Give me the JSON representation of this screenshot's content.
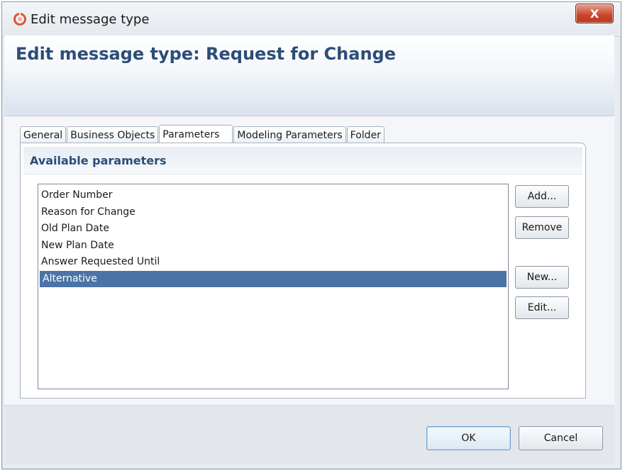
{
  "window": {
    "title": "Edit message type",
    "close_label": "X"
  },
  "header": {
    "title": "Edit message type: Request for Change"
  },
  "tabs": [
    {
      "label": "General"
    },
    {
      "label": "Business Objects"
    },
    {
      "label": "Parameters",
      "active": true
    },
    {
      "label": "Modeling Parameters"
    },
    {
      "label": "Folder"
    }
  ],
  "section": {
    "title": "Available parameters"
  },
  "parameters": {
    "items": [
      {
        "label": "Order Number"
      },
      {
        "label": "Reason for Change"
      },
      {
        "label": "Old Plan Date"
      },
      {
        "label": "New Plan Date"
      },
      {
        "label": "Answer Requested Until"
      },
      {
        "label": "Alternative",
        "selected": true
      }
    ]
  },
  "side_buttons": {
    "add": "Add...",
    "remove": "Remove",
    "new": "New...",
    "edit": "Edit..."
  },
  "footer": {
    "ok": "OK",
    "cancel": "Cancel"
  },
  "colors": {
    "accent_title": "#2c4d77",
    "selection": "#4b74a6",
    "close_button": "#c8452b",
    "app_icon": "#d9572c"
  },
  "icons": {
    "app": "app-logo-icon",
    "close": "close-icon"
  }
}
